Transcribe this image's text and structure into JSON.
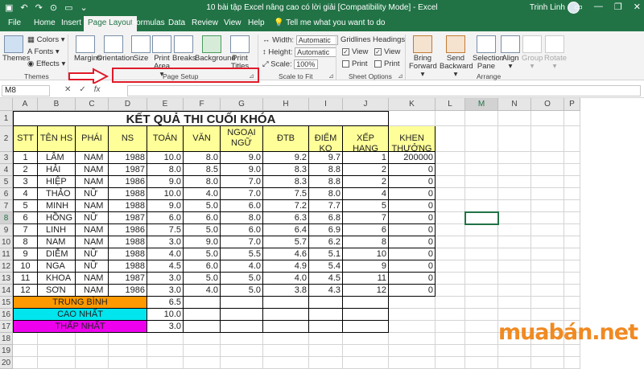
{
  "window": {
    "title": "10 bài tập Excel nâng cao có lời giải  [Compatibility Mode]  -  Excel",
    "user": "Trinh Linh",
    "qat": [
      "▣",
      "↶",
      "↷",
      "⊙",
      "▭",
      "⌄"
    ],
    "controls": [
      "▭",
      "—",
      "❐",
      "✕"
    ]
  },
  "tabs": [
    "File",
    "Home",
    "Insert",
    "Page Layout",
    "Formulas",
    "Data",
    "Review",
    "View",
    "Help"
  ],
  "tell_me": "Tell me what you want to do",
  "ribbon": {
    "themes": {
      "themes": "Themes",
      "colors": "Colors ▾",
      "fonts": "Fonts ▾",
      "effects": "Effects ▾",
      "label": "Themes"
    },
    "page_setup": {
      "margins": "Margins",
      "orientation": "Orientation",
      "size": "Size",
      "print_area": "Print Area ▾",
      "breaks": "Breaks",
      "background": "Background",
      "print_titles": "Print Titles",
      "label": "Page Setup"
    },
    "scale": {
      "width_label": "Width:",
      "width_value": "Automatic",
      "height_label": "Height:",
      "height_value": "Automatic",
      "scale_label": "Scale:",
      "scale_value": "100%",
      "label": "Scale to Fit"
    },
    "sheet_options": {
      "gridlines": "Gridlines",
      "headings": "Headings",
      "view": "View",
      "print": "Print",
      "label": "Sheet Options"
    },
    "arrange": {
      "bring_forward": "Bring Forward ▾",
      "send_backward": "Send Backward ▾",
      "selection_pane": "Selection Pane",
      "align": "Align ▾",
      "group": "Group ▾",
      "rotate": "Rotate ▾",
      "label": "Arrange"
    }
  },
  "formula_bar": {
    "name_box": "M8",
    "cancel": "✕",
    "enter": "✓",
    "fx": "fx",
    "content": ""
  },
  "columns": [
    "A",
    "B",
    "C",
    "D",
    "E",
    "F",
    "G",
    "H",
    "I",
    "J",
    "K",
    "L",
    "M",
    "N",
    "O",
    "P"
  ],
  "rows": [
    "1",
    "2",
    "3",
    "4",
    "5",
    "6",
    "7",
    "8",
    "9",
    "10",
    "11",
    "12",
    "13",
    "14",
    "15",
    "16",
    "17",
    "18",
    "19",
    "20"
  ],
  "sheet": {
    "title": "KẾT QUẢ THI CUỐI KHÓA",
    "headers": [
      "STT",
      "TÊN HS",
      "PHÁI",
      "NS",
      "TOÁN",
      "VĂN",
      "NGOẠI NGỮ",
      "ĐTB",
      "ĐIỂM KQ",
      "XẾP HẠNG",
      "KHEN THƯỞNG"
    ],
    "records": [
      [
        "1",
        "LÂM",
        "NAM",
        "1988",
        "10.0",
        "8.0",
        "9.0",
        "9.2",
        "9.7",
        "1",
        "200000"
      ],
      [
        "2",
        "HẢI",
        "NAM",
        "1987",
        "8.0",
        "8.5",
        "9.0",
        "8.3",
        "8.8",
        "2",
        "0"
      ],
      [
        "3",
        "HIỆP",
        "NAM",
        "1986",
        "9.0",
        "8.0",
        "7.0",
        "8.3",
        "8.8",
        "2",
        "0"
      ],
      [
        "4",
        "THẢO",
        "NỮ",
        "1988",
        "10.0",
        "4.0",
        "7.0",
        "7.5",
        "8.0",
        "4",
        "0"
      ],
      [
        "5",
        "MINH",
        "NAM",
        "1988",
        "9.0",
        "5.0",
        "6.0",
        "7.2",
        "7.7",
        "5",
        "0"
      ],
      [
        "6",
        "HỒNG",
        "NỮ",
        "1987",
        "6.0",
        "6.0",
        "8.0",
        "6.3",
        "6.8",
        "7",
        "0"
      ],
      [
        "7",
        "LINH",
        "NAM",
        "1986",
        "7.5",
        "5.0",
        "6.0",
        "6.4",
        "6.9",
        "6",
        "0"
      ],
      [
        "8",
        "NAM",
        "NAM",
        "1988",
        "3.0",
        "9.0",
        "7.0",
        "5.7",
        "6.2",
        "8",
        "0"
      ],
      [
        "9",
        "DIỄM",
        "NỮ",
        "1988",
        "4.0",
        "5.0",
        "5.5",
        "4.6",
        "5.1",
        "10",
        "0"
      ],
      [
        "10",
        "NGA",
        "NỮ",
        "1988",
        "4.5",
        "6.0",
        "4.0",
        "4.9",
        "5.4",
        "9",
        "0"
      ],
      [
        "11",
        "KHOA",
        "NAM",
        "1987",
        "3.0",
        "5.0",
        "5.0",
        "4.0",
        "4.5",
        "11",
        "0"
      ],
      [
        "12",
        "SƠN",
        "NAM",
        "1986",
        "3.0",
        "4.0",
        "5.0",
        "3.8",
        "4.3",
        "12",
        "0"
      ]
    ],
    "summary": [
      {
        "label": "TRUNG BÌNH",
        "value": "6.5",
        "color": "#ff9900"
      },
      {
        "label": "CAO NHẤT",
        "value": "10.0",
        "color": "#00e5ee"
      },
      {
        "label": "THẤP NHẤT",
        "value": "3.0",
        "color": "#ee00ee"
      }
    ],
    "header_color": "#ffff99"
  },
  "watermark": "muabán.net",
  "colors": {
    "excel_green": "#217346",
    "highlight_red": "#e01b2a"
  }
}
